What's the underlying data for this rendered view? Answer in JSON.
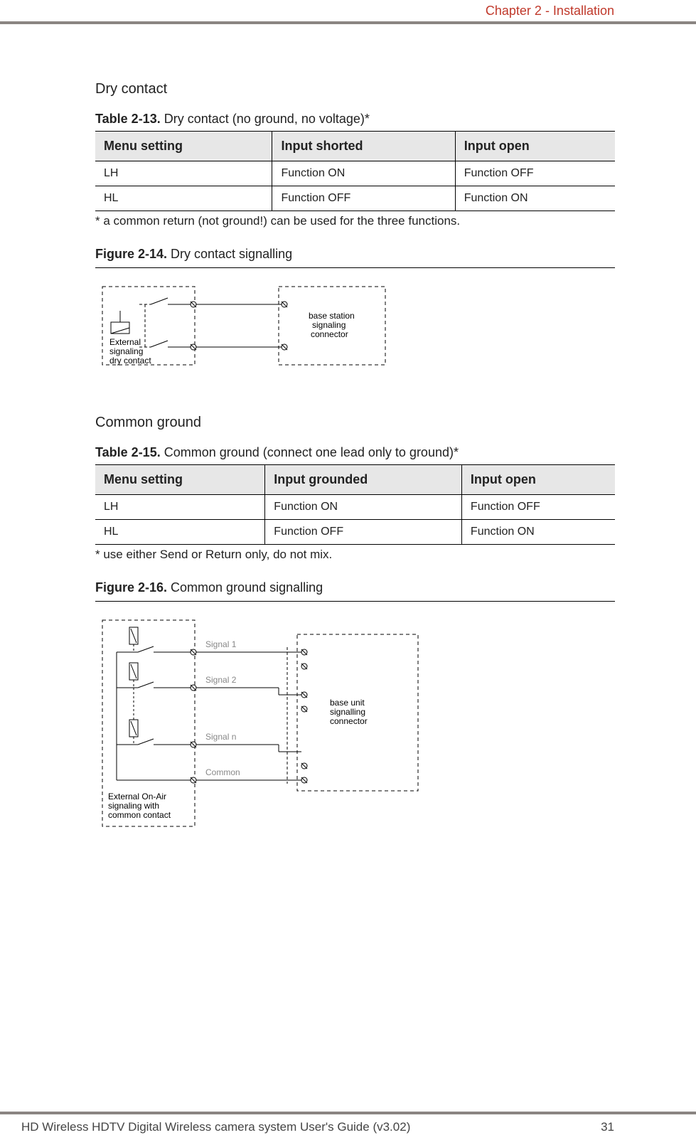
{
  "header": {
    "chapter": "Chapter 2 - Installation"
  },
  "section1": {
    "heading": "Dry contact",
    "tableCaptionBold": "Table 2-13.",
    "tableCaptionRest": "  Dry contact (no ground, no voltage)*",
    "th1": "Menu setting",
    "th2": "Input shorted",
    "th3": "Input open",
    "r1c1": "LH",
    "r1c2": "Function ON",
    "r1c3": "Function OFF",
    "r2c1": "HL",
    "r2c2": "Function OFF",
    "r2c3": "Function ON",
    "note": "* a common return (not ground!) can be used for the three functions.",
    "figCaptionBold": "Figure 2-14.",
    "figCaptionRest": "  Dry contact signalling",
    "figLabelLeft1": "External",
    "figLabelLeft2": "signaling",
    "figLabelLeft3": "dry contact",
    "figLabelRight1": "base station",
    "figLabelRight2": "signaling",
    "figLabelRight3": "connector"
  },
  "section2": {
    "heading": "Common ground",
    "tableCaptionBold": "Table 2-15.",
    "tableCaptionRest": "  Common ground (connect one lead only  to ground)*",
    "th1": "Menu setting",
    "th2": "Input grounded",
    "th3": "Input open",
    "r1c1": "LH",
    "r1c2": "Function ON",
    "r1c3": "Function OFF",
    "r2c1": "HL",
    "r2c2": "Function OFF",
    "r2c3": "Function ON",
    "note": "* use either Send or Return only, do not mix.",
    "figCaptionBold": "Figure 2-16.",
    "figCaptionRest": "  Common ground signalling",
    "sig1": "Signal 1",
    "sig2": "Signal 2",
    "sign": "Signal n",
    "common": "Common",
    "extLabel1": "External On-Air",
    "extLabel2": "signaling with",
    "extLabel3": "common contact",
    "baseLabel1": "base unit",
    "baseLabel2": "signalling",
    "baseLabel3": "connector"
  },
  "footer": {
    "left": "HD Wireless HDTV Digital Wireless camera system User's Guide (v3.02)",
    "right": "31"
  }
}
